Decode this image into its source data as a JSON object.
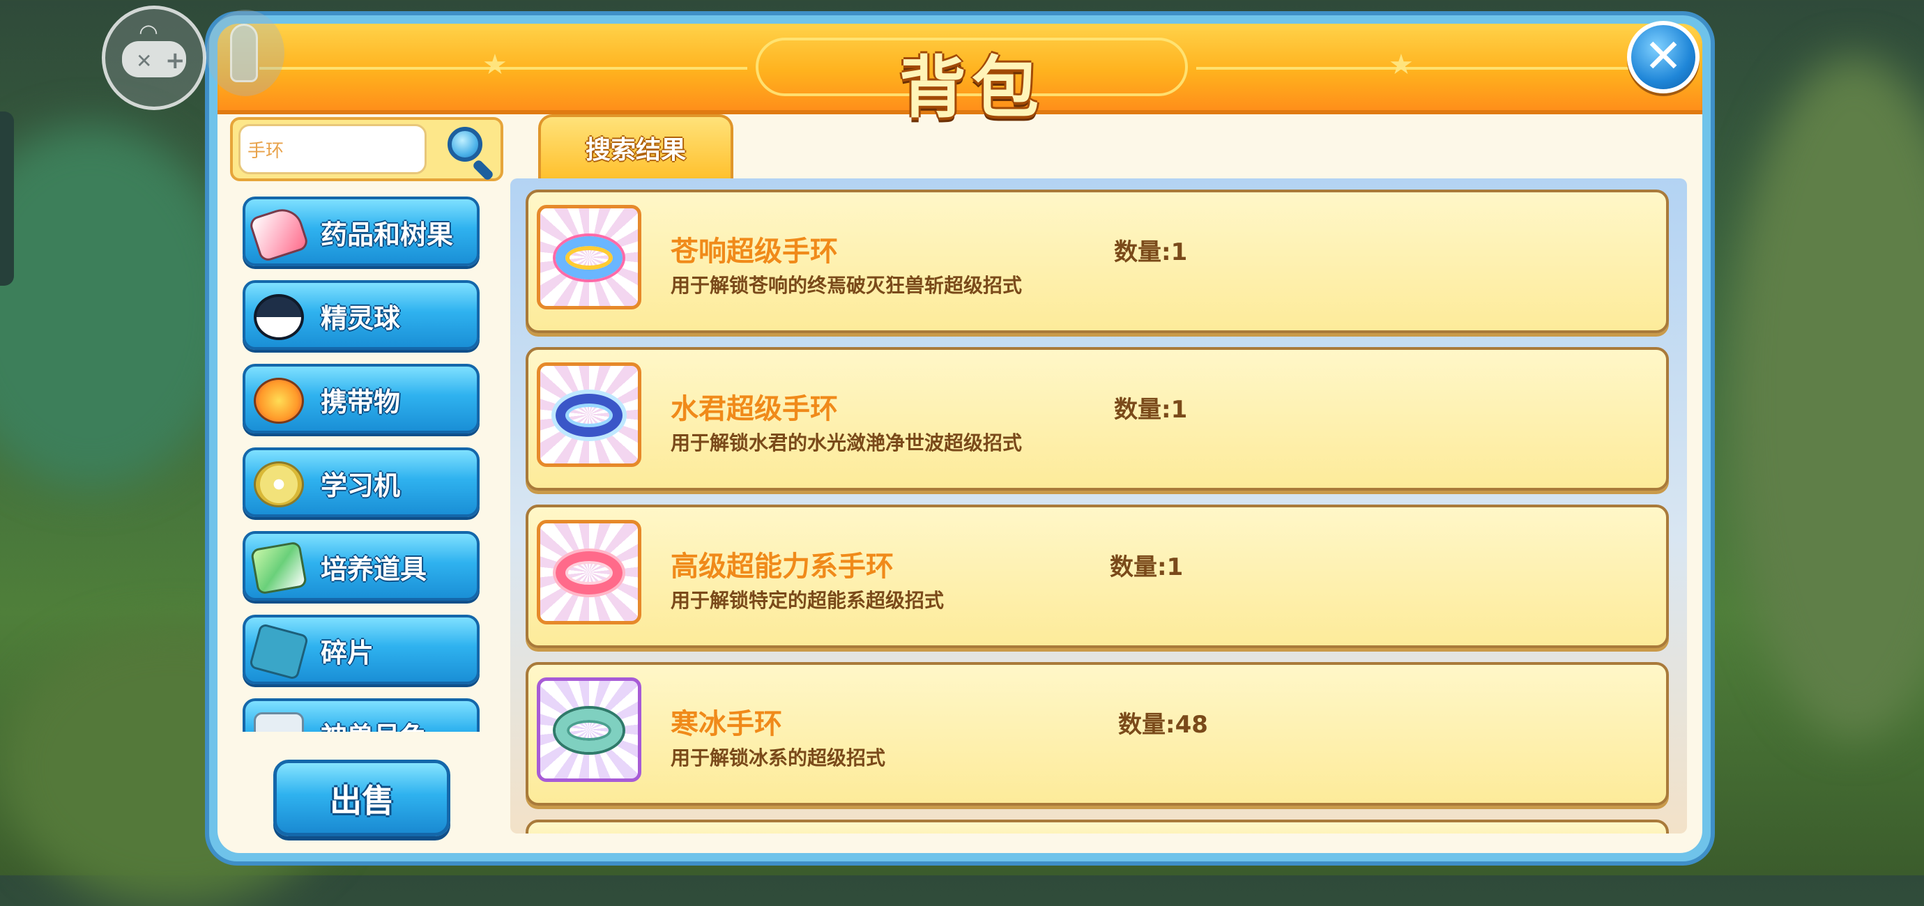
{
  "header": {
    "title": "背包"
  },
  "search": {
    "value": "手环"
  },
  "categories": [
    {
      "label": "药品和树果",
      "icon": "potion-icon"
    },
    {
      "label": "精灵球",
      "icon": "pokeball-icon"
    },
    {
      "label": "携带物",
      "icon": "held-item-icon"
    },
    {
      "label": "学习机",
      "icon": "disc-icon"
    },
    {
      "label": "培养道具",
      "icon": "training-item-icon"
    },
    {
      "label": "碎片",
      "icon": "puzzle-piece-icon"
    },
    {
      "label": "神兽吊兔",
      "icon": "legendary-item-icon"
    }
  ],
  "tabs": [
    {
      "label": "搜索结果",
      "active": true
    }
  ],
  "items": [
    {
      "name": "苍响超级手环",
      "description": "用于解锁苍响的终焉破灭狂兽斩超级招式",
      "quantity": "数量:1"
    },
    {
      "name": "水君超级手环",
      "description": "用于解锁水君的水光潋滟净世波超级招式",
      "quantity": "数量:1"
    },
    {
      "name": "高级超能力系手环",
      "description": "用于解锁特定的超能系超级招式",
      "quantity": "数量:1"
    },
    {
      "name": "寒冰手环",
      "description": "用于解锁冰系的超级招式",
      "quantity": "数量:48"
    }
  ],
  "sell_button": {
    "label": "出售"
  },
  "colors": {
    "header_orange": "#ffb21e",
    "category_blue": "#2fb2ef",
    "item_name_orange": "#f08a1a",
    "item_text_brown": "#7a4a1a",
    "card_cream": "#fdeb9a"
  }
}
